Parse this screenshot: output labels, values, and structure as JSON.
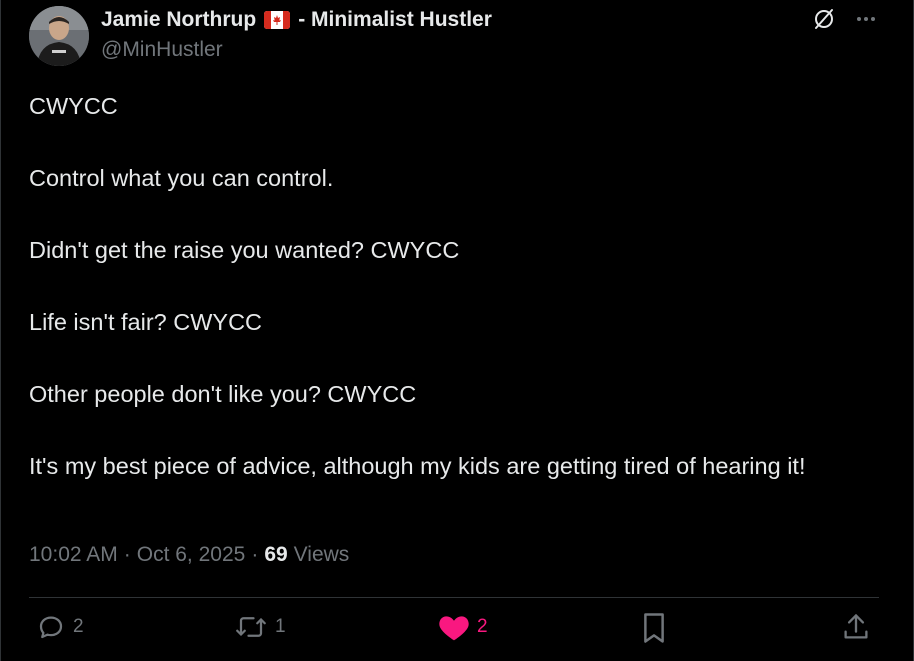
{
  "author": {
    "display_name": "Jamie Northrup",
    "name_suffix": "- Minimalist Hustler",
    "flag_icon": "canada-flag-icon",
    "handle": "@MinHustler"
  },
  "tweet": {
    "paragraphs": [
      "CWYCC",
      "Control what you can control.",
      "Didn't get the raise you wanted? CWYCC",
      "Life isn't fair? CWYCC",
      "Other people don't like you? CWYCC",
      "It's my best piece of advice, although my kids are getting tired of hearing it!"
    ],
    "time": "10:02 AM",
    "separator": "·",
    "date": "Oct 6, 2025",
    "views_count": "69",
    "views_label": "Views"
  },
  "actions": {
    "reply_count": "2",
    "retweet_count": "1",
    "like_count": "2"
  },
  "colors": {
    "background": "#000000",
    "text": "#e7e9ea",
    "muted": "#71767b",
    "divider": "#2f3336",
    "like": "#f91880"
  }
}
